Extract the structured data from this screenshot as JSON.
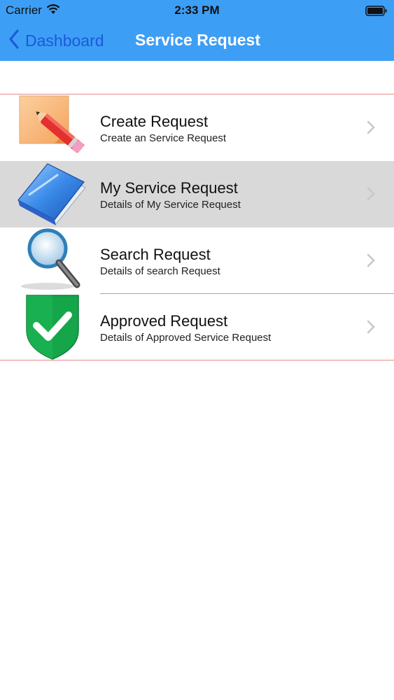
{
  "status_bar": {
    "carrier": "Carrier",
    "time": "2:33 PM",
    "wifi_icon": "wifi-icon",
    "battery_icon": "battery-icon"
  },
  "nav": {
    "back_label": "Dashboard",
    "title": "Service Request",
    "accent": "#3d9ef5",
    "back_color": "#1a5bd8"
  },
  "items": [
    {
      "title": "Create Request",
      "subtitle": "Create an Service Request",
      "icon": "pencil-note-icon",
      "selected": false
    },
    {
      "title": "My Service Request",
      "subtitle": "Details of My Service Request",
      "icon": "book-icon",
      "selected": true
    },
    {
      "title": "Search Request",
      "subtitle": "Details of search Request",
      "icon": "magnifier-icon",
      "selected": false
    },
    {
      "title": "Approved Request",
      "subtitle": "Details of Approved Service Request",
      "icon": "check-shield-icon",
      "selected": false
    }
  ],
  "separator_color": "#e28a8a"
}
